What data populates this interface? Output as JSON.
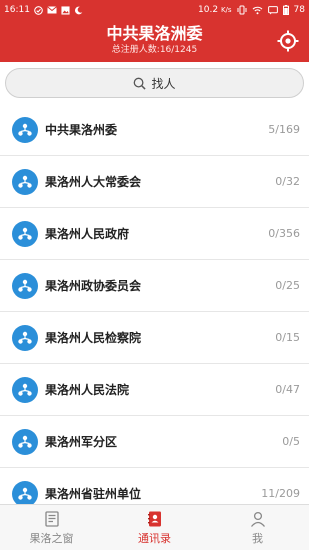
{
  "status_bar": {
    "time": "16:11",
    "speed": "10.2",
    "speed_unit": "K/s",
    "battery": "78"
  },
  "header": {
    "title": "中共果洛洲委",
    "subtitle": "总注册人数:16/1245"
  },
  "search": {
    "label": "找人"
  },
  "list": [
    {
      "name": "中共果洛州委",
      "count": "5/169"
    },
    {
      "name": "果洛州人大常委会",
      "count": "0/32"
    },
    {
      "name": "果洛州人民政府",
      "count": "0/356"
    },
    {
      "name": "果洛州政协委员会",
      "count": "0/25"
    },
    {
      "name": "果洛州人民检察院",
      "count": "0/15"
    },
    {
      "name": "果洛州人民法院",
      "count": "0/47"
    },
    {
      "name": "果洛州军分区",
      "count": "0/5"
    },
    {
      "name": "果洛州省驻州单位",
      "count": "11/209"
    }
  ],
  "tabs": [
    {
      "label": "果洛之窗",
      "icon": "document-icon",
      "active": false
    },
    {
      "label": "通讯录",
      "icon": "contacts-book-icon",
      "active": true
    },
    {
      "label": "我",
      "icon": "person-icon",
      "active": false
    }
  ],
  "colors": {
    "brand_red": "#d8332f",
    "avatar_blue": "#2b8fd9",
    "count_gray": "#9a9a9a"
  }
}
